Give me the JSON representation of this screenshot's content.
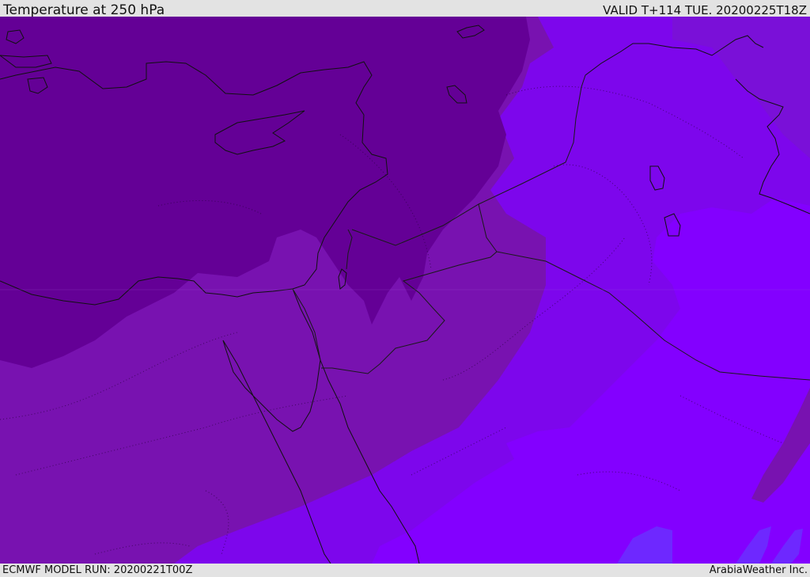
{
  "header": {
    "title": "Temperature at 250 hPa",
    "valid_time": "VALID T+114 TUE. 20200225T18Z"
  },
  "footer": {
    "model_run": "ECMWF MODEL RUN: 20200221T00Z",
    "credit": "ArabiaWeather Inc."
  },
  "map": {
    "variable": "temperature",
    "level": "250 hPa",
    "colors": {
      "coldest": "#640096",
      "cold": "#7812b0",
      "mid": "#7d06ec",
      "warm": "#8300ff",
      "warmest": "#6e28ff",
      "coastline": "#111111",
      "border": "#1a1a1a"
    }
  }
}
